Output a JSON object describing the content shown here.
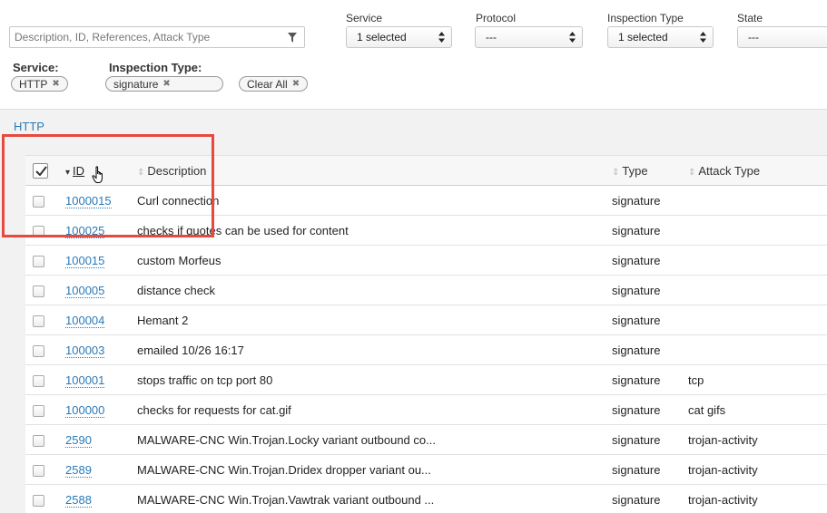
{
  "search": {
    "placeholder": "Description, ID, References, Attack Type"
  },
  "filters": [
    {
      "label": "Service",
      "value": "1 selected"
    },
    {
      "label": "Protocol",
      "value": "---"
    },
    {
      "label": "Inspection Type",
      "value": "1 selected"
    },
    {
      "label": "State",
      "value": "---"
    }
  ],
  "active_filters": {
    "service_label": "Service:",
    "inspection_label": "Inspection Type:",
    "service_chip": "HTTP",
    "inspection_chip": "signature",
    "clear_all": "Clear All",
    "remove_glyph": "✖"
  },
  "panel": {
    "title": "HTTP"
  },
  "table": {
    "columns": {
      "id": "ID",
      "description": "Description",
      "type": "Type",
      "attack_type": "Attack Type"
    },
    "sort_glyph": "⇕",
    "sort_active_glyph": "▾",
    "rows": [
      {
        "id": "1000015",
        "description": "Curl connection",
        "type": "signature",
        "attack_type": ""
      },
      {
        "id": "100025",
        "description": "checks if quotes can be used for content",
        "type": "signature",
        "attack_type": ""
      },
      {
        "id": "100015",
        "description": "custom Morfeus",
        "type": "signature",
        "attack_type": ""
      },
      {
        "id": "100005",
        "description": "distance check",
        "type": "signature",
        "attack_type": ""
      },
      {
        "id": "100004",
        "description": "Hemant 2",
        "type": "signature",
        "attack_type": ""
      },
      {
        "id": "100003",
        "description": "emailed 10/26 16:17",
        "type": "signature",
        "attack_type": ""
      },
      {
        "id": "100001",
        "description": "stops traffic on tcp port 80",
        "type": "signature",
        "attack_type": "tcp"
      },
      {
        "id": "100000",
        "description": "checks for requests for cat.gif",
        "type": "signature",
        "attack_type": "cat gifs"
      },
      {
        "id": "2590",
        "description": "MALWARE-CNC Win.Trojan.Locky variant outbound co...",
        "type": "signature",
        "attack_type": "trojan-activity"
      },
      {
        "id": "2589",
        "description": "MALWARE-CNC Win.Trojan.Dridex dropper variant ou...",
        "type": "signature",
        "attack_type": "trojan-activity"
      },
      {
        "id": "2588",
        "description": "MALWARE-CNC Win.Trojan.Vawtrak variant outbound ...",
        "type": "signature",
        "attack_type": "trojan-activity"
      }
    ]
  },
  "colors": {
    "link": "#2a7ab8",
    "highlight": "#e8493e",
    "panel_bg": "#f2f2f2"
  },
  "icons": {
    "search_filter": "funnel-icon",
    "select": "up-down-arrows-icon",
    "cursor": "hand-pointer-icon",
    "remove": "x-icon"
  }
}
